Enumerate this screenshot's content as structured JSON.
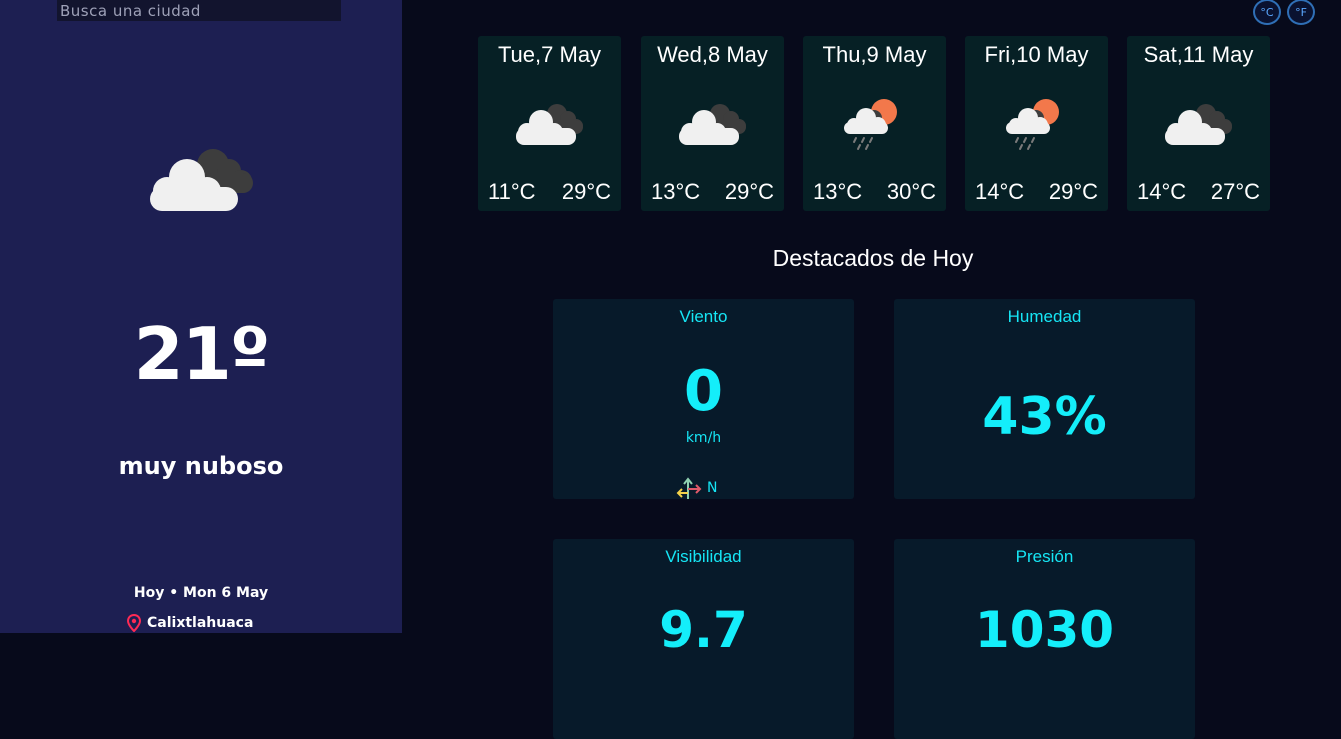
{
  "search": {
    "placeholder": "Busca una ciudad"
  },
  "current": {
    "icon": "cloudy-icon",
    "temperature": "21º",
    "description": "muy nuboso",
    "date": "Hoy • Mon 6 May",
    "location": "Calixtlahuaca"
  },
  "units": {
    "celsius": "°C",
    "fahrenheit": "°F"
  },
  "forecast": [
    {
      "day": "Tue,7 May",
      "icon": "cloudy-icon",
      "min": "11°C",
      "max": "29°C"
    },
    {
      "day": "Wed,8 May",
      "icon": "cloudy-icon",
      "min": "13°C",
      "max": "29°C"
    },
    {
      "day": "Thu,9 May",
      "icon": "rain-sun-icon",
      "min": "13°C",
      "max": "30°C"
    },
    {
      "day": "Fri,10 May",
      "icon": "rain-sun-icon",
      "min": "14°C",
      "max": "29°C"
    },
    {
      "day": "Sat,11 May",
      "icon": "cloudy-icon",
      "min": "14°C",
      "max": "27°C"
    }
  ],
  "highlights": {
    "title": "Destacados de Hoy",
    "wind": {
      "label": "Viento",
      "value": "0",
      "unit": "km/h",
      "direction": "N"
    },
    "humidity": {
      "label": "Humedad",
      "value": "43%"
    },
    "visibility": {
      "label": "Visibilidad",
      "value": "9.7"
    },
    "pressure": {
      "label": "Presión",
      "value": "1030"
    }
  },
  "colors": {
    "sidebar": "#1d1f52",
    "background": "#070a1b",
    "card": "#062025",
    "accent": "#14eefa"
  }
}
